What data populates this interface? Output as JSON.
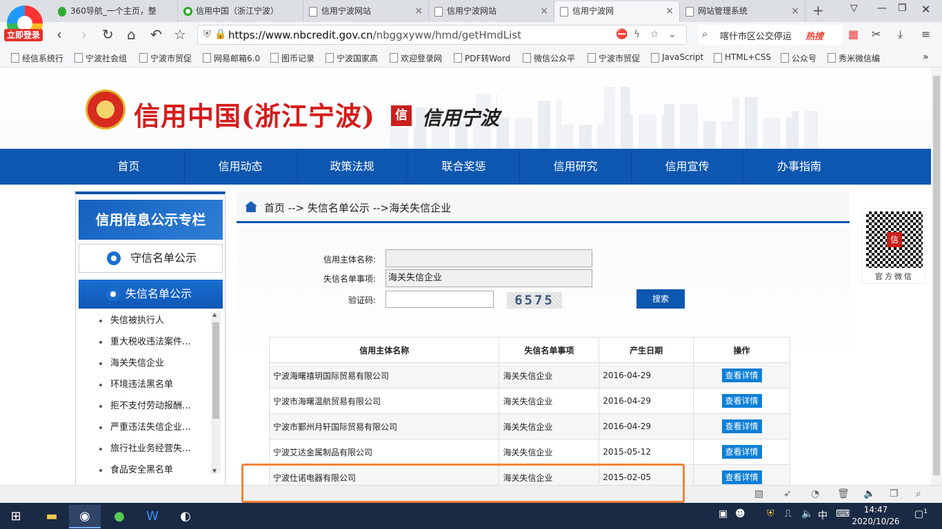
{
  "browser": {
    "login_badge": "立即登录",
    "tabs": [
      {
        "label": "360导航_一个主页，整",
        "active": false
      },
      {
        "label": "信用中国（浙江宁波）",
        "active": false
      },
      {
        "label": "信用宁波网站",
        "active": false
      },
      {
        "label": "信用宁波网站",
        "active": false
      },
      {
        "label": "信用宁波网",
        "active": true
      },
      {
        "label": "网站管理系统",
        "active": false
      }
    ],
    "new_tab_symbol": "+",
    "url_domain": "https://www.nbcredit.gov.cn",
    "url_path": "/nbggxyww/hmd/getHmdList",
    "search_query": "喀什市区公交停运",
    "search_hot": "热搜",
    "bookmarks": [
      "经信系统行",
      "宁波社会组",
      "宁波市贸促",
      "网易邮箱6.0",
      "图币记录",
      "宁波国家高",
      "欢迎登录网",
      "PDF转Word",
      "微信公众平",
      "宁波市贸促",
      "JavaScript",
      "HTML+CSS",
      "公众号",
      "秀米微信编"
    ],
    "bookmarks_more": "»"
  },
  "site": {
    "title": "信用中国(浙江宁波)",
    "logo_mark": "信",
    "subtitle": "信用宁波",
    "nav": [
      "首页",
      "信用动态",
      "政策法规",
      "联合奖惩",
      "信用研究",
      "信用宣传",
      "办事指南"
    ]
  },
  "sidebar": {
    "header": "信用信息公示专栏",
    "red_list_button": "守信名单公示",
    "black_list_header": "失信名单公示",
    "items": [
      "失信被执行人",
      "重大税收违法案件...",
      "海关失信企业",
      "环境违法黑名单",
      "拒不支付劳动报酬...",
      "严重违法失信企业...",
      "旅行社业务经营失...",
      "食品安全黑名单"
    ]
  },
  "breadcrumb": "首页 --> 失信名单公示 -->海关失信企业",
  "search_form": {
    "name_label": "信用主体名称:",
    "name_value": "",
    "type_label": "失信名单事项:",
    "type_value": "海关失信企业",
    "captcha_label": "验证码:",
    "captcha_value": "",
    "captcha_image_text": "6575",
    "search_button": "搜索"
  },
  "table": {
    "headers": [
      "信用主体名称",
      "失信名单事项",
      "产生日期",
      "操作"
    ],
    "rows": [
      {
        "name": "宁波海曙禧玥国际贸易有限公司",
        "type": "海关失信企业",
        "date": "2016-04-29",
        "action": "查看详情"
      },
      {
        "name": "宁波市海曙温航贸易有限公司",
        "type": "海关失信企业",
        "date": "2016-04-29",
        "action": "查看详情"
      },
      {
        "name": "宁波市鄞州月轩国际贸易有限公司",
        "type": "海关失信企业",
        "date": "2016-04-29",
        "action": "查看详情"
      },
      {
        "name": "宁波艾达金属制品有限公司",
        "type": "海关失信企业",
        "date": "2015-05-12",
        "action": "查看详情"
      },
      {
        "name": "宁波仕诺电器有限公司",
        "type": "海关失信企业",
        "date": "2015-02-05",
        "action": "查看详情"
      }
    ]
  },
  "qr_label": "官方微信",
  "taskbar": {
    "time": "14:47",
    "date": "2020/10/26",
    "ime": "中",
    "notify_count": "1"
  },
  "colors": {
    "nav_blue": "#0d57b0",
    "title_red": "#d51c1c",
    "highlight_orange": "#f6823a",
    "detail_button": "#0d7fd6"
  }
}
